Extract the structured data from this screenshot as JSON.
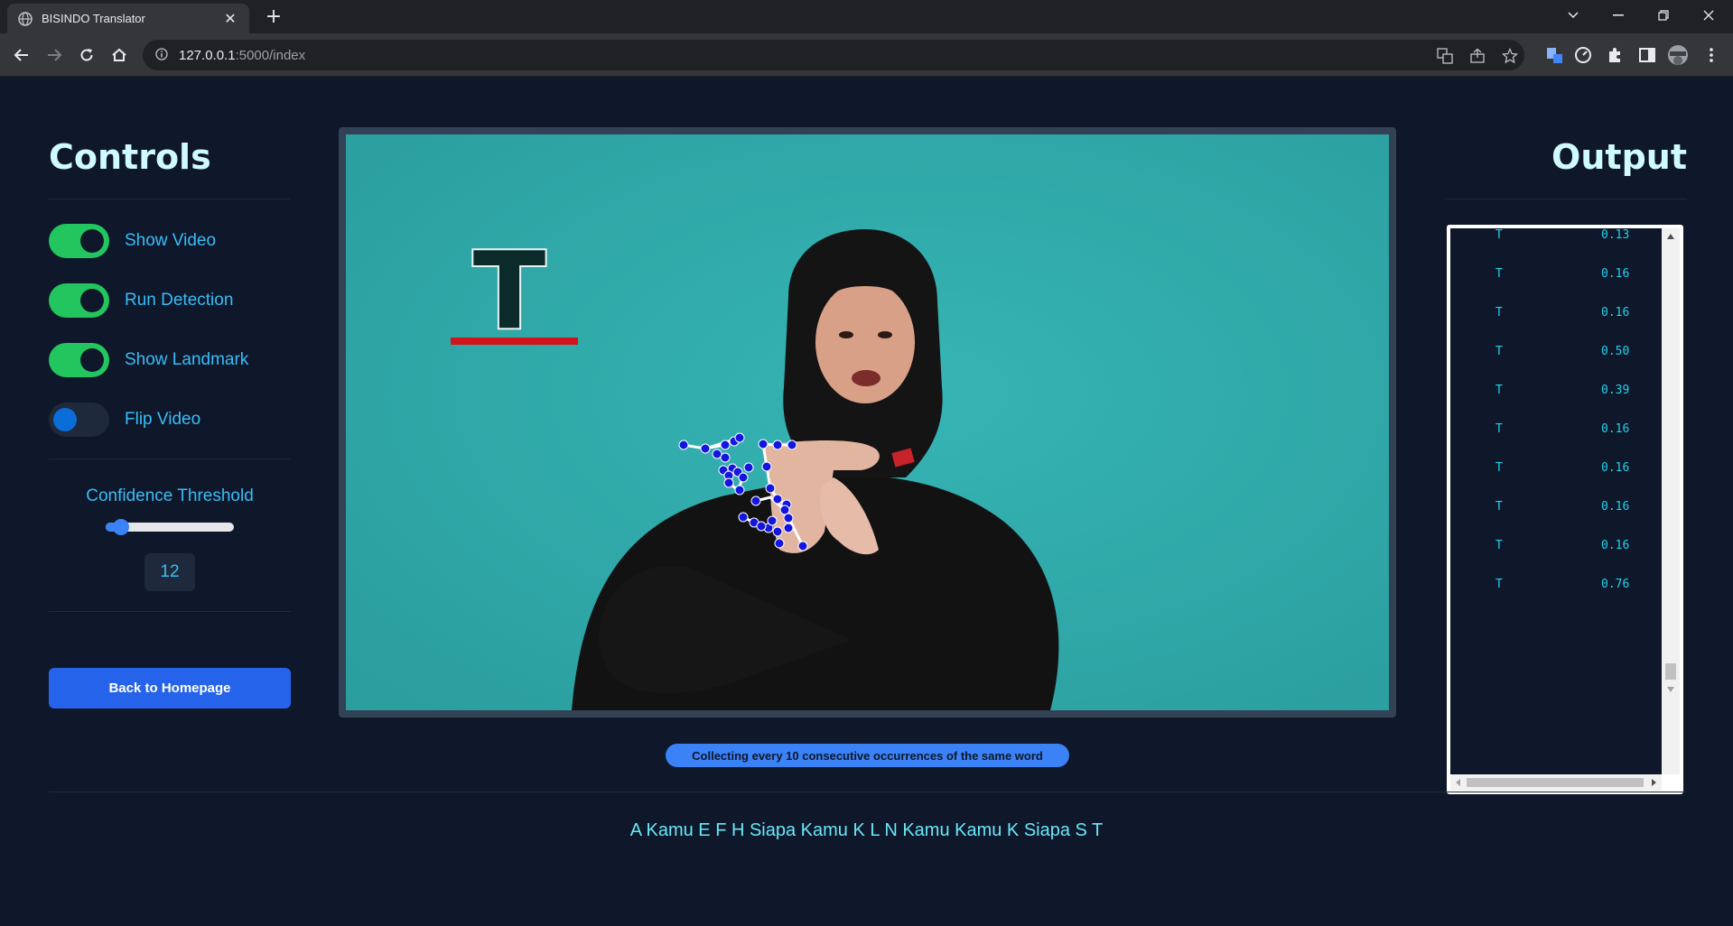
{
  "browser": {
    "tab_title": "BISINDO Translator",
    "url_host": "127.0.0.1",
    "url_rest": ":5000/index"
  },
  "controls": {
    "title": "Controls",
    "toggles": [
      {
        "label": "Show Video",
        "on": true
      },
      {
        "label": "Run Detection",
        "on": true
      },
      {
        "label": "Show Landmark",
        "on": true
      },
      {
        "label": "Flip Video",
        "on": false
      }
    ],
    "threshold_label": "Confidence Threshold",
    "threshold_value": "12",
    "threshold_fraction": 0.12,
    "back_button": "Back to Homepage"
  },
  "video": {
    "detected_letter": "T"
  },
  "output": {
    "title": "Output",
    "rows": [
      {
        "label": "T",
        "score": "0.13"
      },
      {
        "label": "T",
        "score": "0.16"
      },
      {
        "label": "T",
        "score": "0.16"
      },
      {
        "label": "T",
        "score": "0.50"
      },
      {
        "label": "T",
        "score": "0.39"
      },
      {
        "label": "T",
        "score": "0.16"
      },
      {
        "label": "T",
        "score": "0.16"
      },
      {
        "label": "T",
        "score": "0.16"
      },
      {
        "label": "T",
        "score": "0.16"
      },
      {
        "label": "T",
        "score": "0.76"
      }
    ]
  },
  "status": "Collecting every 10 consecutive occurrences of the same word",
  "sentence": "A Kamu E F H Siapa Kamu K L N Kamu Kamu K Siapa S T",
  "colors": {
    "background": "#0f172a",
    "accent_green": "#22c55e",
    "accent_blue": "#2563eb",
    "text_cyan": "#38bdf8",
    "video_bg": "#2fa9aa"
  }
}
